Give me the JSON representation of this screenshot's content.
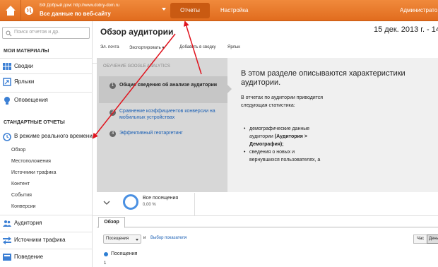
{
  "topbar": {
    "site_line1": "БФ Добрый дом: http://www.dobry-dom.ru",
    "site_line2": "Все данные по веб-сайту",
    "reports_tab": "Отчеты",
    "settings_tab": "Настройка",
    "admin_tab": "Администрато"
  },
  "sidebar": {
    "search_placeholder": "Поиск отчетов и др.",
    "my_materials": "МОИ МАТЕРИАЛЫ",
    "dashboards": "Сводки",
    "shortcuts": "Ярлыки",
    "alerts": "Оповещения",
    "standard_reports": "СТАНДАРТНЫЕ ОТЧЕТЫ",
    "realtime": "В режиме реального времени",
    "realtime_items": [
      "Обзор",
      "Местоположения",
      "Источники трафика",
      "Контент",
      "События",
      "Конверсии"
    ],
    "audience": "Аудитория",
    "traffic_sources": "Источники трафика",
    "behavior": "Поведение"
  },
  "header": {
    "title": "Обзор аудитории",
    "date_range": "15 дек. 2013 г. - 14",
    "toolbar": {
      "email": "Эл. почта",
      "export": "Экспортировать ▾",
      "add_dashboard": "Добавить в сводку",
      "shortcut": "Ярлык"
    }
  },
  "panel": {
    "heading": "ОБУЧЕНИЕ GOOGLE ANALYTICS",
    "steps": [
      {
        "num": "1",
        "label": "Общие сведения об анализе аудитории"
      },
      {
        "num": "2",
        "label": "Сравнение коэффициентов конверсии на мобильных устройствах"
      },
      {
        "num": "3",
        "label": "Эффективный геотаргетинг"
      }
    ],
    "right_title": "В этом разделе описываются характеристики аудитории.",
    "right_body": "В отчетах по аудитории приводится следующая статистика:",
    "bullet1_a": "демографические данные аудитории",
    "bullet1_b": "(Аудитория > Демография);",
    "bullet2": "сведения о новых и вернувшихся пользователях, а"
  },
  "stats": {
    "visits_label": "Все посещения",
    "visits_value": "0,00 %"
  },
  "tabs": {
    "overview": "Обзор"
  },
  "controls": {
    "metric_select": "Посещения",
    "and": "и",
    "pick_metric": "Выбор показателя",
    "hour": "Час",
    "day": "День"
  },
  "chart": {
    "legend": "Посещения",
    "axis_top": "1"
  },
  "colors": {
    "topbar": "#e8772a",
    "active_tab": "#c95a12",
    "link": "#1a5fb4",
    "annotation_arrow": "#e0141e"
  }
}
